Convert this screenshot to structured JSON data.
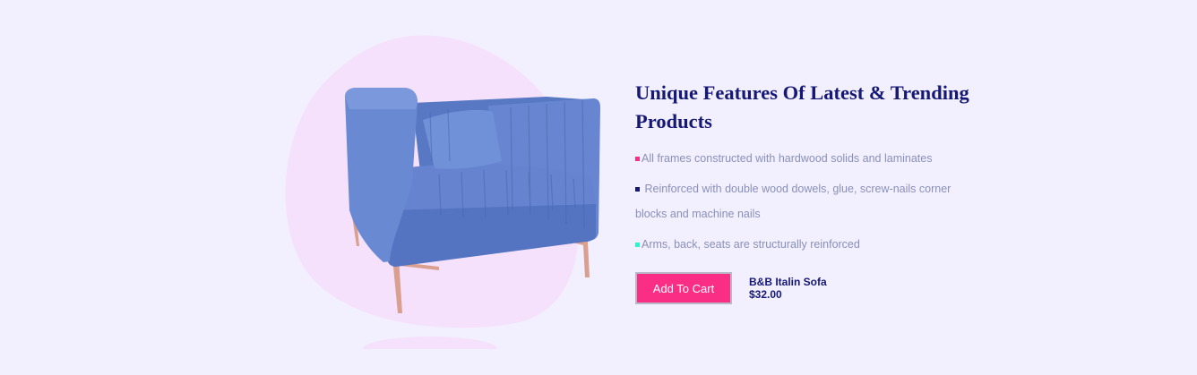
{
  "section": {
    "title": "Unique Features Of Latest & Trending Products",
    "features": [
      {
        "text": "All frames constructed with hardwood solids and laminates",
        "bullet_color": "#fb2e86"
      },
      {
        "text": " Reinforced with double wood dowels, glue, screw-nails corner blocks and machine nails",
        "bullet_color": "#151875"
      },
      {
        "text": "Arms, back, seats are structurally reinforced",
        "bullet_color": "#2bf5cc"
      }
    ],
    "cta": {
      "label": "Add To Cart"
    },
    "product": {
      "name": "B&B Italin Sofa",
      "price": "$32.00"
    }
  },
  "colors": {
    "background": "#f2f0ff",
    "blob": "#f5e1fc",
    "heading": "#151875",
    "body_text": "#8a8fb9",
    "accent": "#fb2e86",
    "sofa": "#5f7fcd"
  }
}
